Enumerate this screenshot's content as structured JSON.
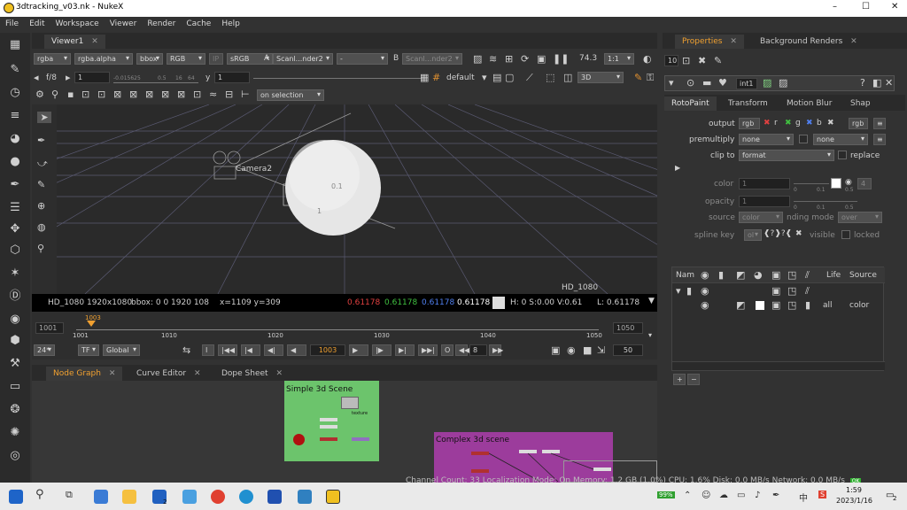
{
  "window": {
    "title": "3dtracking_v03.nk - NukeX",
    "minimize": "–",
    "maximize": "☐",
    "close": "✕"
  },
  "menu": [
    "File",
    "Edit",
    "Workspace",
    "Viewer",
    "Render",
    "Cache",
    "Help"
  ],
  "viewer": {
    "tab": "Viewer1",
    "tab_close": "✕",
    "toolbar1": {
      "channels": "rgba",
      "alpha": "rgba.alpha",
      "bbox": "bbox",
      "rgb": "RGB",
      "ip": "IP",
      "lut": "sRGB",
      "a_label": "A",
      "a_input": "Scanl...nder2",
      "a_dash": "-",
      "b_label": "B",
      "b_input": "Scanl...nder2",
      "zoom": "74.3",
      "ratio": "1:1"
    },
    "toolbar2": {
      "fstop": "f/8",
      "gain": "1",
      "gain_ticks": [
        "-0.015625",
        "0.5",
        "16",
        "64"
      ],
      "gamma_label": "y",
      "gamma": "1",
      "default": "default",
      "mode": "3D"
    },
    "toolbar3": {
      "selection": "on selection"
    },
    "scene": {
      "camera_label": "Camera2",
      "label_01": "0.1",
      "label_1": "1",
      "format": "HD_1080"
    },
    "info": {
      "format": "HD_1080 1920x1080",
      "bbox": "bbox: 0 0 1920 108",
      "xy": "x=1109 y=309",
      "r": "0.61178",
      "g": "0.61178",
      "b": "0.61178",
      "a": "0.61178",
      "hsv": "H:   0 S:0.00 V:0.61",
      "l": "L: 0.61178"
    },
    "timeline": {
      "start": "1001",
      "end": "1050",
      "current_marker": "1003",
      "ticks": [
        "1001",
        "1010",
        "1020",
        "1030",
        "1040",
        "1050"
      ]
    },
    "playback": {
      "fps": "24*",
      "tf": "TF",
      "global": "Global",
      "frame": "1003",
      "step": "8",
      "end_frame": "50",
      "o": "O"
    }
  },
  "nodegraph": {
    "tabs": [
      "Node Graph",
      "Curve Editor",
      "Dope Sheet"
    ],
    "backdrop1": {
      "label": "Simple 3d Scene",
      "color": "#6cc46c"
    },
    "backdrop2": {
      "label": "Complex 3d scene",
      "color": "#9c3c9c"
    },
    "texture_label": "texture"
  },
  "properties": {
    "tabs": [
      "Properties",
      "Background Renders"
    ],
    "count": "10",
    "node_name": "int1",
    "subtabs": [
      "RotoPaint",
      "Transform",
      "Motion Blur",
      "Shap"
    ],
    "output_label": "output",
    "output_value": "rgb",
    "output_channels": [
      "r",
      "g",
      "b"
    ],
    "output_rgb": "rgb",
    "premultiply_label": "premultiply",
    "premultiply_value": "none",
    "premultiply_value2": "none",
    "clipto_label": "clip to",
    "clipto_value": "format",
    "replace_label": "replace",
    "color_label": "color",
    "color_value": "1",
    "color_ticks": [
      "0",
      "0.1",
      "0.5"
    ],
    "color_count": "4",
    "opacity_label": "opacity",
    "opacity_value": "1",
    "source_label": "source",
    "source_value": "color",
    "blending_label": "nding mode",
    "blending_value": "over",
    "spline_label": "spline key",
    "spline_value": "ol",
    "visible_label": "visible",
    "locked_label": "locked",
    "layer_headers": [
      "Nam",
      "Life",
      "Source"
    ],
    "layer_row": {
      "life": "all",
      "source": "color"
    }
  },
  "status": "Channel Count: 33  Localization Mode: On  Memory: 1.2 GB (1.0%) CPU: 1.6% Disk: 0.0 MB/s Network: 0.0 MB/s",
  "taskbar": {
    "battery": "99%",
    "ime": "中",
    "time": "1:59",
    "date": "2023/1/16",
    "notify": "2",
    "mail_badge": "2"
  }
}
